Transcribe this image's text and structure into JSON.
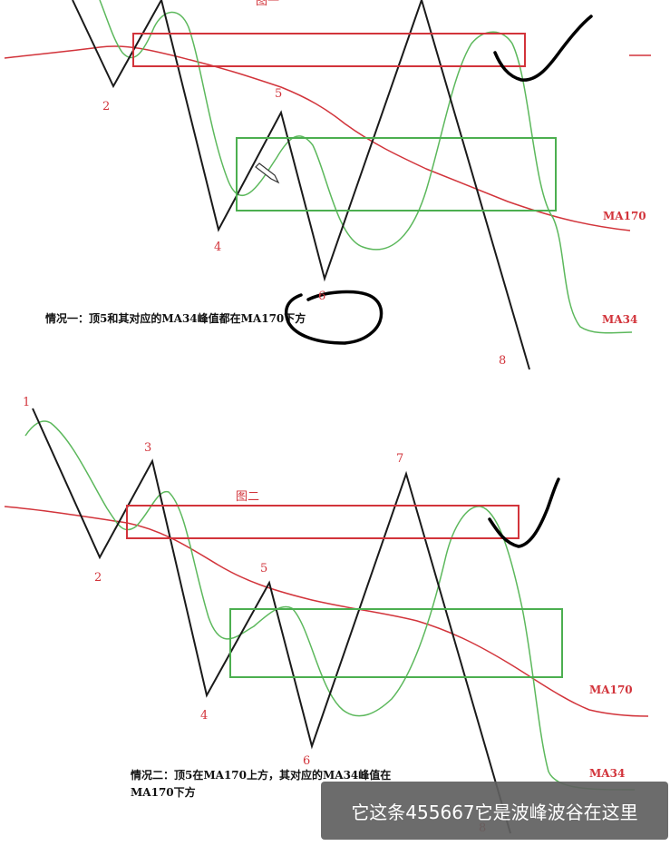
{
  "top": {
    "title": "图一",
    "points": [
      "2",
      "4",
      "5",
      "6",
      "8"
    ],
    "ma170_label": "MA170",
    "ma34_label": "MA34",
    "caption": "情况一：顶5和其对应的MA34峰值都在MA170下方"
  },
  "bottom": {
    "title": "图二",
    "points": [
      "1",
      "2",
      "3",
      "4",
      "5",
      "6",
      "7",
      "8"
    ],
    "ma170_label": "MA170",
    "ma34_label": "MA34",
    "caption_line1": "情况二：顶5在MA170上方，其对应的MA34峰值在",
    "caption_line2": "MA170下方"
  },
  "subtitle": "它这条455667它是波峰波谷在这里",
  "colors": {
    "zigzag": "#1a1a1a",
    "ma170": "#d2343b",
    "ma34": "#5cb85c",
    "red_box": "#d2343b",
    "green_box": "#4caf50",
    "ink": "#000000"
  }
}
